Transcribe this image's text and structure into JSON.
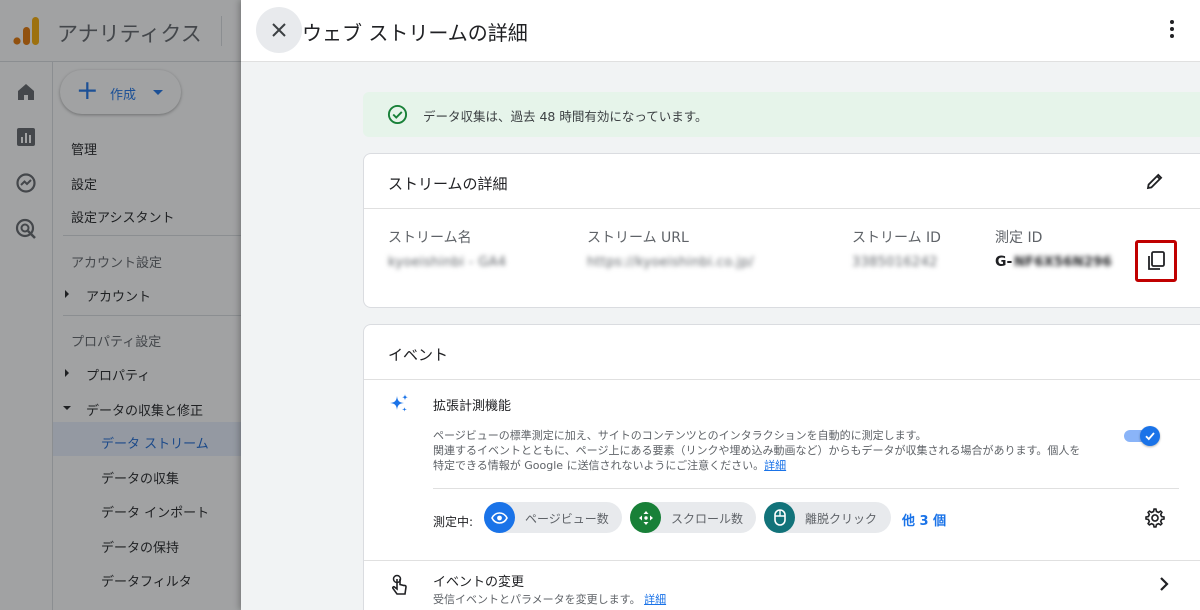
{
  "app": {
    "title": "アナリティクス",
    "nav": {
      "create_label": "作成",
      "items": {
        "admin": "管理",
        "settings": "設定",
        "setup_assistant": "設定アシスタント",
        "account_settings_header": "アカウント設定",
        "account": "アカウント",
        "property_settings_header": "プロパティ設定",
        "property": "プロパティ",
        "data_collection_modify": "データの収集と修正",
        "data_streams": "データ ストリーム",
        "data_collection": "データの収集",
        "data_import": "データ インポート",
        "data_retention": "データの保持",
        "data_filter": "データフィルタ"
      }
    }
  },
  "panel": {
    "title": "ウェブ ストリームの詳細",
    "notice": "データ収集は、過去 48 時間有効になっています。",
    "stream_details": {
      "title": "ストリームの詳細",
      "labels": {
        "name": "ストリーム名",
        "url": "ストリーム URL",
        "id": "ストリーム ID",
        "measurement_id": "測定 ID"
      },
      "values": {
        "name": "kyoeishinbi - GA4",
        "url": "https://kyoeishinbi.co.jp/",
        "id": "3385016242",
        "measurement_id_prefix": "G-",
        "measurement_id_hidden": "NF6X56N296"
      }
    },
    "events": {
      "title": "イベント",
      "enhanced": {
        "title": "拡張計測機能",
        "desc_line1": "ページビューの標準測定に加え、サイトのコンテンツとのインタラクションを自動的に測定します。",
        "desc_line2": "関連するイベントとともに、ページ上にある要素（リンクや埋め込み動画など）からもデータが収集される場合があります。個人を",
        "desc_line3": "特定できる情報が Google に送信されないようにご注意ください。",
        "learn_more": "詳細",
        "enabled": true
      },
      "measuring_label": "測定中:",
      "chips": [
        {
          "label": "ページビュー数",
          "color": "#1a73e8"
        },
        {
          "label": "スクロール数",
          "color": "#188038"
        },
        {
          "label": "離脱クリック",
          "color": "#12737a"
        }
      ],
      "more": "他 3 個",
      "modify": {
        "title": "イベントの変更",
        "desc": "受信イベントとパラメータを変更します。",
        "learn_more": "詳細"
      }
    }
  },
  "colors": {
    "accent": "#1a73e8",
    "notice_bg": "#e6f4ea",
    "notice_icon": "#188038",
    "highlight": "#c00000"
  }
}
